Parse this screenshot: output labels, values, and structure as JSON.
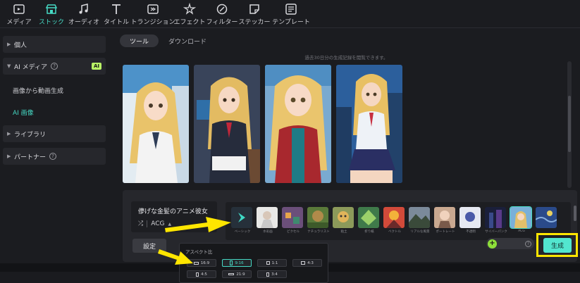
{
  "toolbar": {
    "items": [
      {
        "label": "メディア",
        "icon": "media-icon"
      },
      {
        "label": "ストック",
        "icon": "stock-icon",
        "active": true
      },
      {
        "label": "オーディオ",
        "icon": "audio-icon"
      },
      {
        "label": "タイトル",
        "icon": "title-icon"
      },
      {
        "label": "トランジション",
        "icon": "transition-icon"
      },
      {
        "label": "エフェクト",
        "icon": "effect-icon"
      },
      {
        "label": "フィルター",
        "icon": "filter-icon"
      },
      {
        "label": "ステッカー",
        "icon": "sticker-icon"
      },
      {
        "label": "テンプレート",
        "icon": "template-icon"
      }
    ]
  },
  "sidebar": {
    "personal": "個人",
    "ai_media": "AI メディア",
    "ai_badge": "AI",
    "sub_image_to_video": "画像から動画生成",
    "sub_ai_image": "AI 画像",
    "library": "ライブラリ",
    "partner": "パートナー"
  },
  "main": {
    "tab_tools": "ツール",
    "tab_download": "ダウンロード",
    "history_note": "過去30日分の生成記録を閲覧できます。"
  },
  "generate": {
    "prompt": "儚げな金髪のアニメ彼女",
    "style_value": "ACG",
    "settings_label": "設定",
    "generate_label": "生成",
    "styles": [
      {
        "label": "ベーシック"
      },
      {
        "label": "水彩画"
      },
      {
        "label": "ピクセル"
      },
      {
        "label": "ナチュラリスト"
      },
      {
        "label": "粘土"
      },
      {
        "label": "折り紙"
      },
      {
        "label": "ベクトル"
      },
      {
        "label": "リアルな風景"
      },
      {
        "label": "ポートレート"
      },
      {
        "label": "不透明"
      },
      {
        "label": "サイバーパンク"
      },
      {
        "label": "ACG"
      },
      {
        "label": ""
      }
    ]
  },
  "aspect": {
    "title": "アスペクト比",
    "ratios": [
      "16:9",
      "9:16",
      "1:1",
      "4:3",
      "4:5",
      "21:9",
      "3:4"
    ],
    "selected": "9:16"
  },
  "colors": {
    "accent": "#46d9c4",
    "highlight": "#ffe600",
    "ai_badge": "#b9f266"
  }
}
